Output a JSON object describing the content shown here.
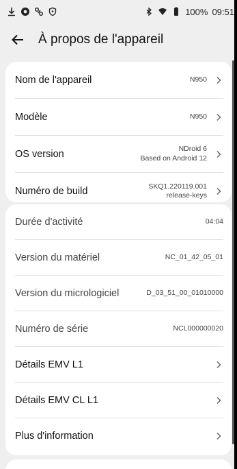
{
  "status": {
    "time": "09:51",
    "battery": "100%"
  },
  "header": {
    "title": "À propos de l'appareil"
  },
  "card1": [
    {
      "label": "Nom de l'appareil",
      "value_lines": [
        "N950"
      ]
    },
    {
      "label": "Modèle",
      "value_lines": [
        "N950"
      ]
    },
    {
      "label": "OS version",
      "value_lines": [
        "NDroid 6",
        "Based on Android 12"
      ]
    },
    {
      "label": "Numéro de build",
      "value_lines": [
        "SKQ1.220119.001",
        "release-keys"
      ]
    }
  ],
  "card2": [
    {
      "label": "Durée d'activité",
      "value": "04:04"
    },
    {
      "label": "Version du matériel",
      "value": "NC_01_42_05_01"
    },
    {
      "label": "Version du micrologiciel",
      "value": "D_03_51_00_01010000"
    },
    {
      "label": "Numéro de série",
      "value": "NCL000000020"
    },
    {
      "label": "Détails EMV L1",
      "value": ""
    },
    {
      "label": "Détails EMV CL L1",
      "value": ""
    },
    {
      "label": "Plus d'information",
      "value": ""
    }
  ]
}
